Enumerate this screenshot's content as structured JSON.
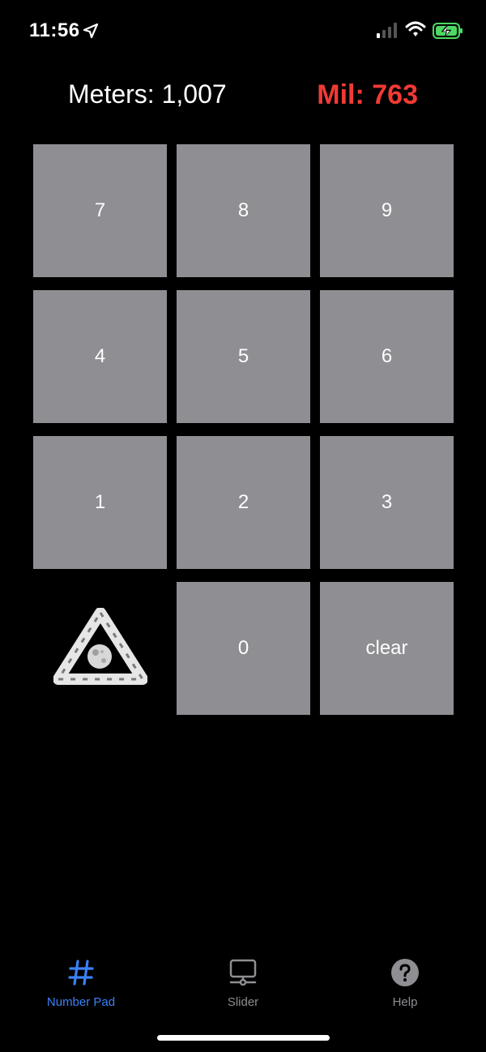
{
  "status_bar": {
    "time": "11:56",
    "icons": [
      "location-arrow-icon",
      "cellular-signal-icon",
      "wifi-icon",
      "battery-charging-icon"
    ]
  },
  "readout": {
    "meters_text": "Meters: 1,007",
    "mil_text": "Mil: 763",
    "mil_color": "#f23a35"
  },
  "keypad": {
    "keys": [
      "7",
      "8",
      "9",
      "4",
      "5",
      "6",
      "1",
      "2",
      "3",
      "0",
      "clear"
    ],
    "logo_icon": "triangle-moon-logo-icon",
    "key_color": "#8e8e93"
  },
  "tabbar": {
    "tabs": [
      {
        "label": "Number Pad",
        "icon": "hash-icon",
        "active": true
      },
      {
        "label": "Slider",
        "icon": "slider-monitor-icon",
        "active": false
      },
      {
        "label": "Help",
        "icon": "question-circle-icon",
        "active": false
      }
    ],
    "active_color": "#3a82f7",
    "inactive_color": "#8e8e93"
  }
}
